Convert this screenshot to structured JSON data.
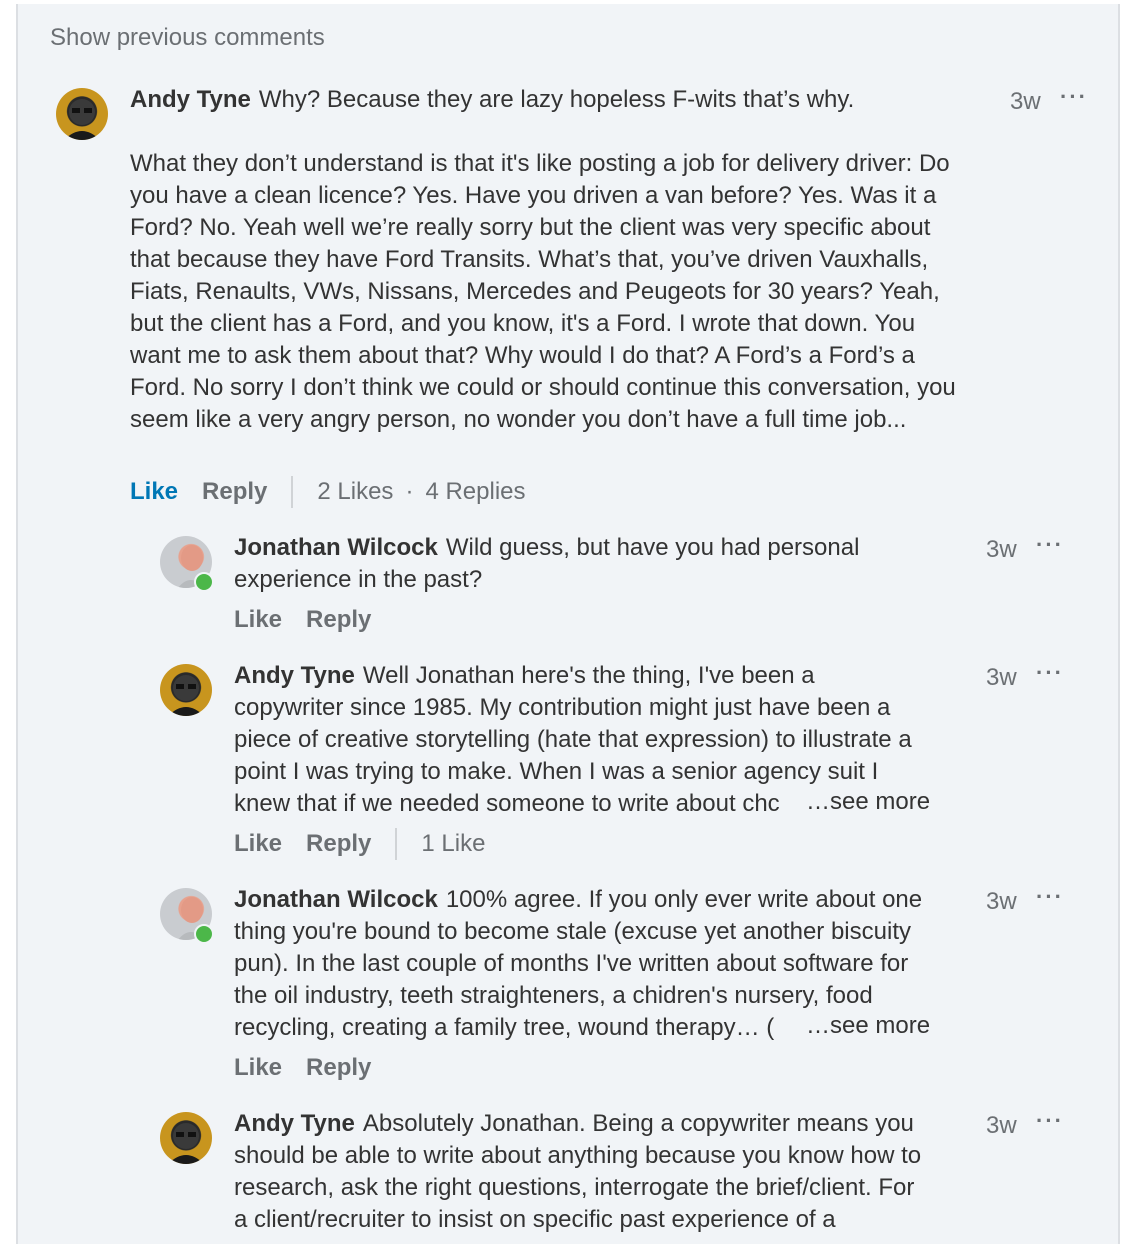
{
  "show_previous": "Show previous comments",
  "comments": [
    {
      "author": "Andy Tyne",
      "time": "3w",
      "paragraphs": [
        "Why? Because they are lazy hopeless F-wits that’s why.",
        "What they don’t understand is that it's like posting a job for delivery driver: Do you have a clean licence? Yes. Have you driven a van before? Yes. Was it a Ford? No. Yeah well we’re really sorry but the client was very specific about that because they have Ford Transits. What’s that, you’ve driven Vauxhalls, Fiats, Renaults, VWs, Nissans, Mercedes and Peugeots for 30 years? Yeah, but the client has a Ford, and you know, it's a Ford. I wrote that down. You want me to ask them about that? Why would I do that? A Ford’s a Ford’s a Ford. No sorry I don’t think we could or should continue this conversation, you seem like a very angry person, no wonder you don’t have a full time job..."
      ],
      "like": "Like",
      "reply": "Reply",
      "likes": "2 Likes",
      "replies": "4 Replies"
    }
  ],
  "replies": [
    {
      "author": "Jonathan Wilcock",
      "time": "3w",
      "text": "Wild guess, but have you had personal experience in the past?",
      "like": "Like",
      "reply": "Reply"
    },
    {
      "author": "Andy Tyne",
      "time": "3w",
      "text": "Well Jonathan here's the thing, I've been a copywriter since 1985. My contribution might just have been a piece of creative storytelling (hate that expression) to illustrate a point I was trying to make. When I was a senior agency suit I",
      "last_line": "knew that if we needed someone to write about chc",
      "see_more": "…see more",
      "like": "Like",
      "reply": "Reply",
      "likes": "1 Like"
    },
    {
      "author": "Jonathan Wilcock",
      "time": "3w",
      "text": "100% agree. If you only ever write about one thing you're bound to become stale (excuse yet another biscuity pun). In the last couple of months I've written about software for the oil industry, teeth straighteners, a chidren's nursery, food",
      "last_line": "recycling, creating a family tree, wound therapy… (",
      "see_more": "…see more",
      "like": "Like",
      "reply": "Reply"
    },
    {
      "author": "Andy Tyne",
      "time": "3w",
      "text": "Absolutely Jonathan. Being a copywriter means you should be able to write about anything because you know how to research, ask the right questions, interrogate the brief/client. For a client/recruiter to insist on specific past experience of a"
    }
  ],
  "more_label": "···"
}
